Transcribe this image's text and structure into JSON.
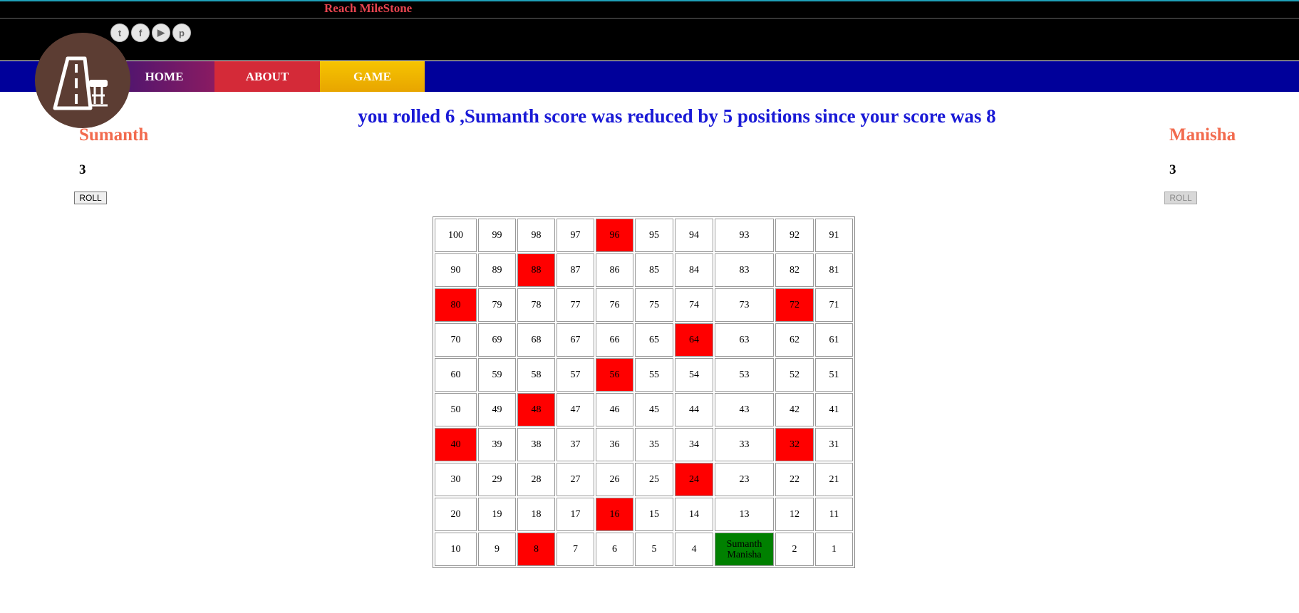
{
  "header": {
    "site_title": "Reach MileStone",
    "social_icons": [
      "twitter-icon",
      "facebook-icon",
      "youtube-icon",
      "pinterest-icon"
    ]
  },
  "nav": {
    "items": [
      {
        "label": "HOME",
        "color": "#7a1a6e"
      },
      {
        "label": "ABOUT",
        "color": "#d42a38"
      },
      {
        "label": "GAME",
        "color": "#f2b800"
      }
    ],
    "bar_color": "#00009a"
  },
  "message": "you rolled 6 ,Sumanth score was reduced by 5 positions since your score was 8",
  "players": {
    "left": {
      "name": "Sumanth",
      "score": "3",
      "roll_label": "ROLL",
      "roll_enabled": true
    },
    "right": {
      "name": "Manisha",
      "score": "3",
      "roll_label": "ROLL",
      "roll_enabled": false
    }
  },
  "board": {
    "rows": [
      [
        "100",
        "99",
        "98",
        "97",
        "96",
        "95",
        "94",
        "93",
        "92",
        "91"
      ],
      [
        "90",
        "89",
        "88",
        "87",
        "86",
        "85",
        "84",
        "83",
        "82",
        "81"
      ],
      [
        "80",
        "79",
        "78",
        "77",
        "76",
        "75",
        "74",
        "73",
        "72",
        "71"
      ],
      [
        "70",
        "69",
        "68",
        "67",
        "66",
        "65",
        "64",
        "63",
        "62",
        "61"
      ],
      [
        "60",
        "59",
        "58",
        "57",
        "56",
        "55",
        "54",
        "53",
        "52",
        "51"
      ],
      [
        "50",
        "49",
        "48",
        "47",
        "46",
        "45",
        "44",
        "43",
        "42",
        "41"
      ],
      [
        "40",
        "39",
        "38",
        "37",
        "36",
        "35",
        "34",
        "33",
        "32",
        "31"
      ],
      [
        "30",
        "29",
        "28",
        "27",
        "26",
        "25",
        "24",
        "23",
        "22",
        "21"
      ],
      [
        "20",
        "19",
        "18",
        "17",
        "16",
        "15",
        "14",
        "13",
        "12",
        "11"
      ],
      [
        "10",
        "9",
        "8",
        "7",
        "6",
        "5",
        "4",
        "Sumanth Manisha",
        "2",
        "1"
      ]
    ],
    "red_cells": [
      "96",
      "88",
      "80",
      "72",
      "64",
      "56",
      "48",
      "40",
      "32",
      "24",
      "16",
      "8"
    ],
    "occupied_cell": {
      "players": [
        "Sumanth",
        "Manisha"
      ],
      "color": "#008000"
    },
    "hazard_color": "#ff0000"
  }
}
